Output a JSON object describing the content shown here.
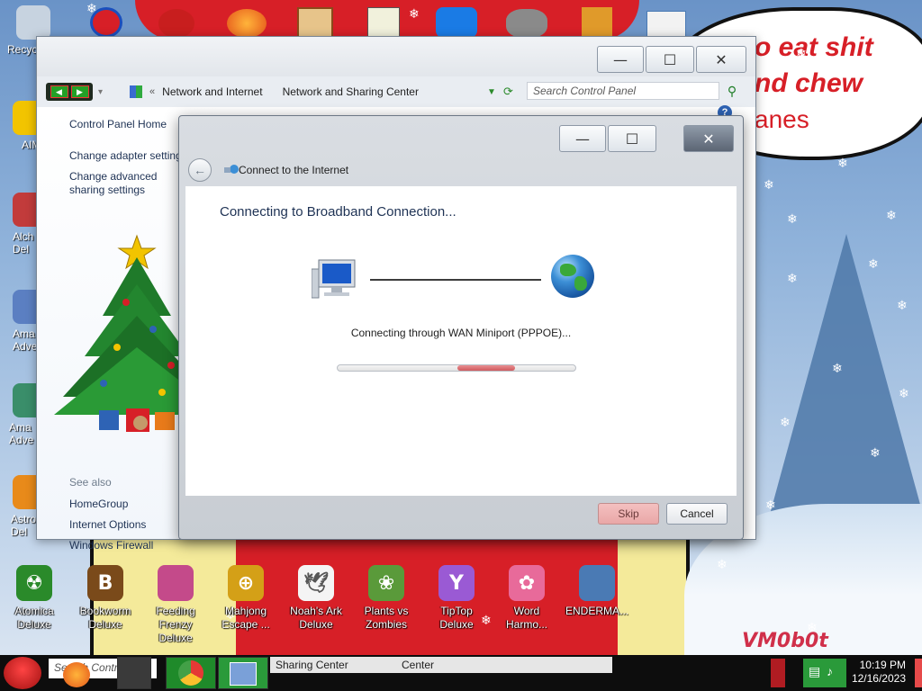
{
  "desktop": {
    "bubble_lines": [
      "o eat shit",
      "nd chew",
      "anes"
    ],
    "watermark": "VM0b0t",
    "top_left_icon": {
      "label": "Recyc",
      "icon": "recycle-bin-icon"
    },
    "left_icons": [
      {
        "label": "AIM",
        "icon": "aim-icon"
      },
      {
        "label": "Alch\nDel",
        "icon": "alchemy-icon"
      },
      {
        "label": "Ama\nAdve",
        "icon": "amazing-adventures-icon"
      },
      {
        "label": "Ama\nAdve",
        "icon": "amazing-adventures-2-icon"
      },
      {
        "label": "Astro\nDel",
        "icon": "astro-icon"
      }
    ],
    "bottom_icons": [
      {
        "label": "Atomica Deluxe",
        "icon": "atomica-icon",
        "color": "#2a8a2a"
      },
      {
        "label": "Bookworm Deluxe",
        "icon": "bookworm-icon",
        "color": "#7a4a1a"
      },
      {
        "label": "Feeding Frenzy Deluxe",
        "icon": "feeding-frenzy-icon",
        "color": "#c44a8a"
      },
      {
        "label": "Mahjong Escape ...",
        "icon": "mahjong-icon",
        "color": "#d4a017"
      },
      {
        "label": "Noah's Ark Deluxe",
        "icon": "noahs-ark-icon",
        "color": "#e8e8e8"
      },
      {
        "label": "Plants vs Zombies",
        "icon": "plants-vs-zombies-icon",
        "color": "#5a9a3a"
      },
      {
        "label": "TipTop Deluxe",
        "icon": "tiptop-icon",
        "color": "#9a5ad4"
      },
      {
        "label": "Word Harmo...",
        "icon": "word-harmony-icon",
        "color": "#e86a9a"
      },
      {
        "label": "ENDERMA...",
        "icon": "enderman-icon",
        "color": "#4a7ab4"
      }
    ]
  },
  "control_panel": {
    "breadcrumb": [
      "Network and Internet",
      "Network and Sharing Center"
    ],
    "search_placeholder": "Search Control Panel",
    "left_links": {
      "home": "Control Panel Home",
      "items": [
        "Change adapter settings",
        "Change advanced sharing settings"
      ]
    },
    "see_also": {
      "label": "See also",
      "items": [
        "HomeGroup",
        "Internet Options",
        "Windows Firewall"
      ]
    }
  },
  "dialog": {
    "title": "Connect to the Internet",
    "heading": "Connecting to Broadband Connection...",
    "status": "Connecting through WAN Miniport (PPPOE)...",
    "skip_label": "Skip",
    "cancel_label": "Cancel",
    "progress_marquee": true
  },
  "taskbar": {
    "search_placeholder": "Search Control",
    "tasks": [
      "Sharing Center",
      "Center"
    ],
    "clock_time": "10:19 PM",
    "clock_date": "12/16/2023"
  }
}
